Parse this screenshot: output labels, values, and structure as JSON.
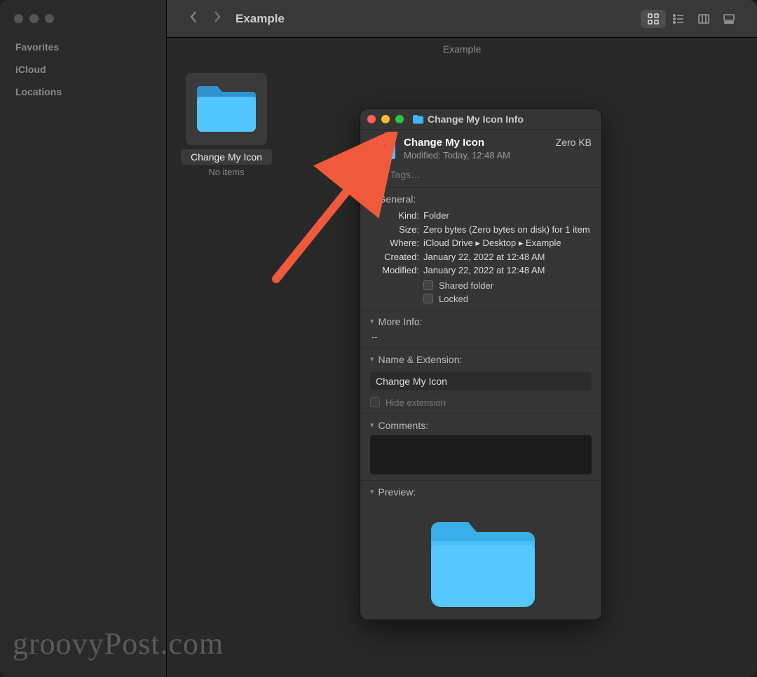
{
  "finder": {
    "title": "Example",
    "path": "Example",
    "sidebar": {
      "favorites": "Favorites",
      "icloud": "iCloud",
      "locations": "Locations"
    },
    "item": {
      "name": "Change My Icon",
      "sub": "No items"
    }
  },
  "info": {
    "windowTitle": "Change My Icon Info",
    "name": "Change My Icon",
    "modified_header": "Modified: Today, 12:48 AM",
    "size_header": "Zero KB",
    "tags_placeholder": "Add Tags…",
    "sections": {
      "general": "General:",
      "moreinfo": "More Info:",
      "nameext": "Name & Extension:",
      "comments": "Comments:",
      "preview": "Preview:"
    },
    "general": {
      "kind_k": "Kind:",
      "kind_v": "Folder",
      "size_k": "Size:",
      "size_v": "Zero bytes (Zero bytes on disk) for 1 item",
      "where_k": "Where:",
      "where_v": "iCloud Drive ▸ Desktop ▸ Example",
      "created_k": "Created:",
      "created_v": "January 22, 2022 at 12:48 AM",
      "modified_k": "Modified:",
      "modified_v": "January 22, 2022 at 12:48 AM",
      "shared": "Shared folder",
      "locked": "Locked"
    },
    "moreinfo_value": "--",
    "name_value": "Change My Icon",
    "hide_ext": "Hide extension"
  },
  "watermark": "groovyPost.com"
}
